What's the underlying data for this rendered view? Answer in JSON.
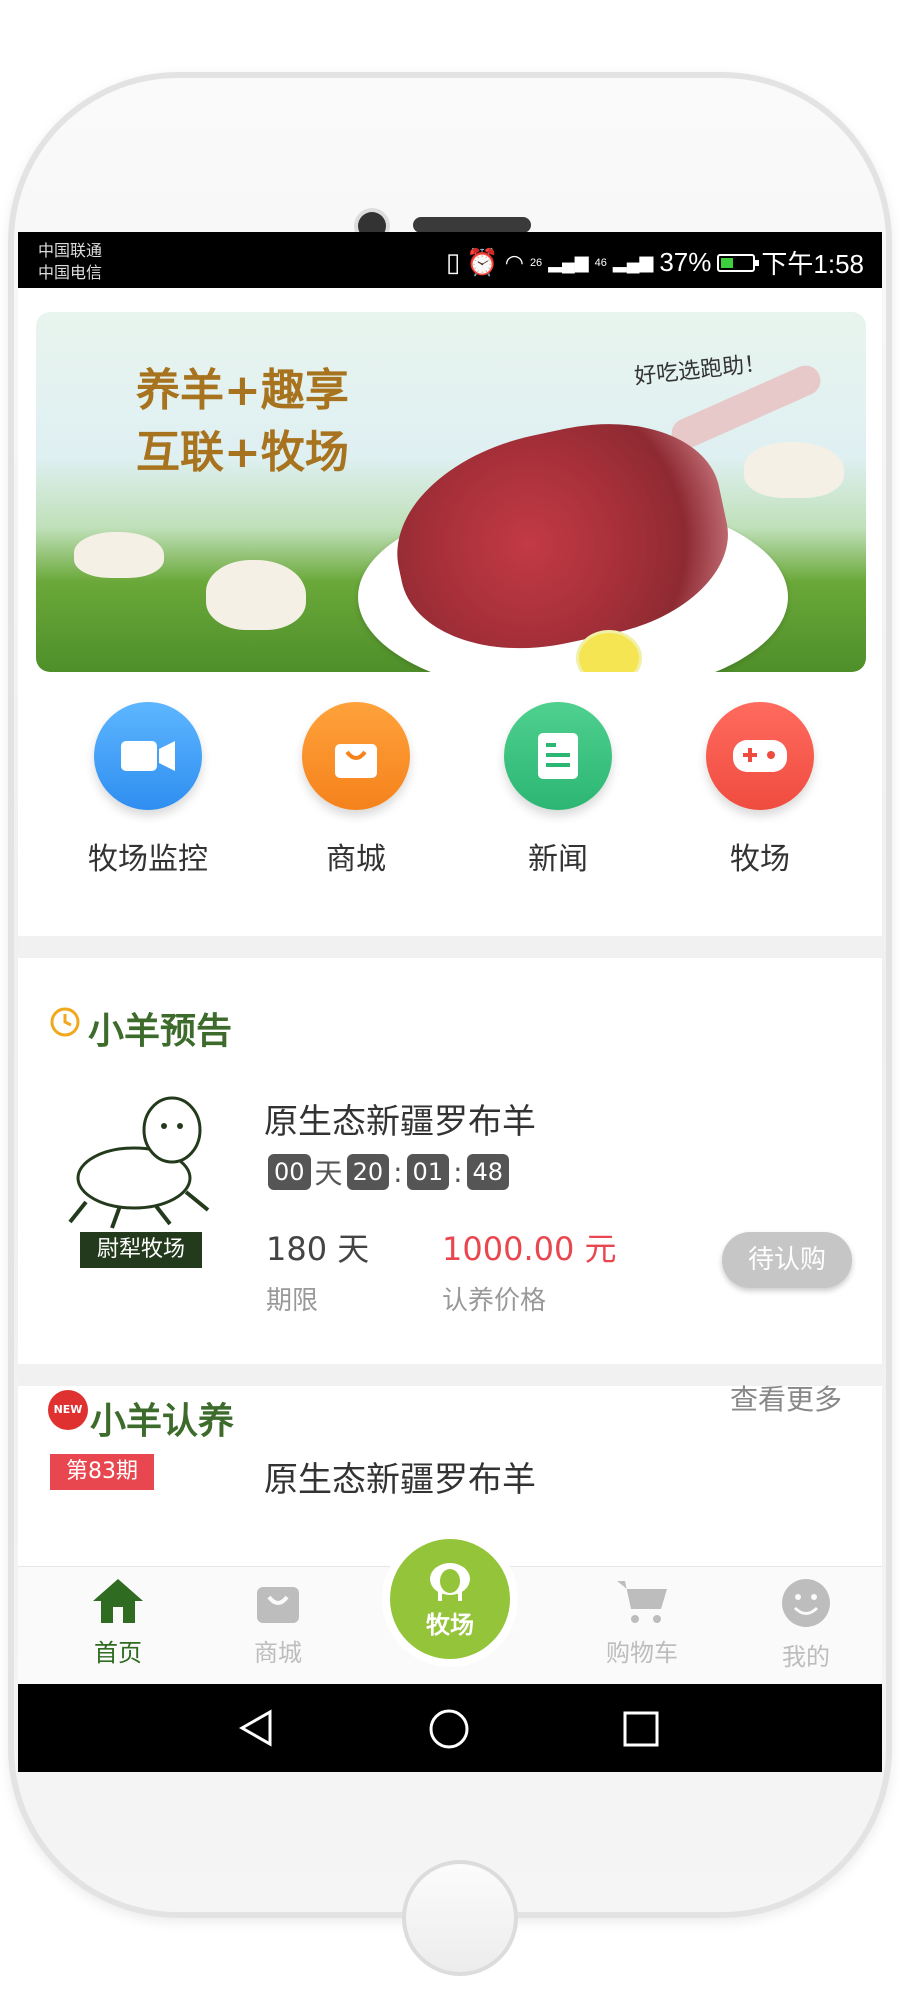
{
  "status_bar": {
    "carrier_1": "中国联通",
    "carrier_2": "中国电信",
    "network_1": "26",
    "network_2": "46",
    "battery": "37%",
    "time": "下午1:58"
  },
  "banner": {
    "line1": "养羊+趣享",
    "line2": "互联+牧场",
    "tagline": "好吃选跑助！"
  },
  "quick_icons": [
    {
      "label": "牧场监控",
      "icon": "video-camera-icon",
      "color": "#3d9ff5"
    },
    {
      "label": "商城",
      "icon": "shopping-bag-icon",
      "color": "#f98d1f"
    },
    {
      "label": "新闻",
      "icon": "news-document-icon",
      "color": "#35c47f"
    },
    {
      "label": "牧场",
      "icon": "gamepad-icon",
      "color": "#f45a4a"
    }
  ],
  "preview_section": {
    "title": "小羊预告",
    "logo_text": "尉犁牧场",
    "product_name": "原生态新疆罗布羊",
    "countdown": {
      "days": "00",
      "day_unit": "天",
      "hours": "20",
      "minutes": "01",
      "seconds": "48",
      "sep": ":"
    },
    "period_value": "180 天",
    "period_label": "期限",
    "price_value": "1000.00 元",
    "price_label": "认养价格",
    "action_button": "待认购"
  },
  "adopt_section": {
    "badge": "NEW",
    "title": "小羊认养",
    "see_more": "查看更多",
    "period_badge": "第83期",
    "product_name_partial": "原生态新疆罗布羊"
  },
  "tab_bar": {
    "tabs": [
      {
        "label": "首页",
        "icon": "home-icon",
        "active": true
      },
      {
        "label": "商城",
        "icon": "shopping-bag-icon",
        "active": false
      },
      {
        "label": "牧场",
        "icon": "sheep-icon",
        "active": false
      },
      {
        "label": "购物车",
        "icon": "shopping-cart-icon",
        "active": false
      },
      {
        "label": "我的",
        "icon": "smiley-face-icon",
        "active": false
      }
    ],
    "active_color": "#2f6b21",
    "inactive_color": "#bdbdbd",
    "center_color": "#94c43a"
  },
  "colors": {
    "accent_green": "#3d6b2b",
    "price_red": "#e9474f"
  }
}
